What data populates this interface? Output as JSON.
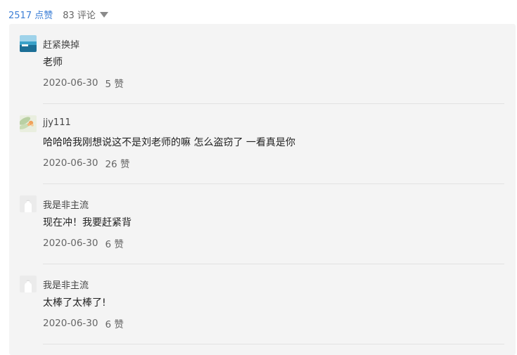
{
  "stats": {
    "likes": "2517 点赞",
    "comments": "83 评论"
  },
  "comments": [
    {
      "user": "赶紧换掉",
      "avatar": "ocean-avatar-icon",
      "content": "老师",
      "date": "2020-06-30",
      "votes": "5 赞"
    },
    {
      "user": "jjy111",
      "avatar": "flower-avatar-icon",
      "content": "哈哈哈我刚想说这不是刘老师的嘛 怎么盗窃了 一看真是你",
      "date": "2020-06-30",
      "votes": "26 赞"
    },
    {
      "user": "我是非主流",
      "avatar": "default-avatar-icon",
      "content": "现在冲！我要赶紧背",
      "date": "2020-06-30",
      "votes": "6 赞"
    },
    {
      "user": "我是非主流",
      "avatar": "default-avatar-icon",
      "content": "太棒了太棒了!",
      "date": "2020-06-30",
      "votes": "6 赞"
    }
  ],
  "colors": {
    "accent": "#3d7fd6",
    "panel": "#f4f4f4"
  }
}
